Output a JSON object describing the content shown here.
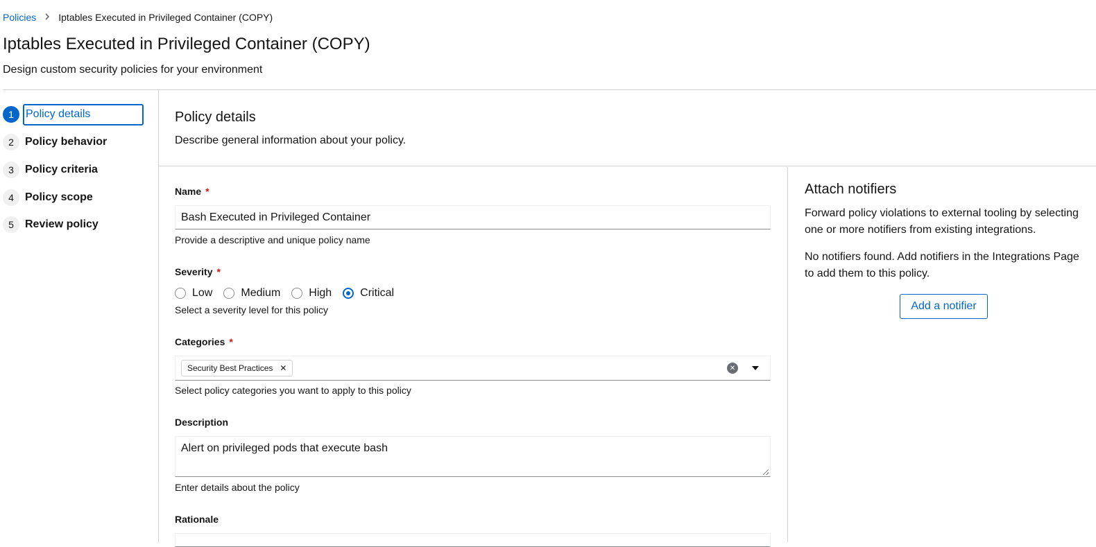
{
  "breadcrumb": {
    "parent": "Policies",
    "current": "Iptables Executed in Privileged Container (COPY)"
  },
  "page": {
    "title": "Iptables Executed in Privileged Container (COPY)",
    "subtitle": "Design custom security policies for your environment"
  },
  "wizard_nav": {
    "steps": [
      {
        "num": "1",
        "label": "Policy details",
        "active": true
      },
      {
        "num": "2",
        "label": "Policy behavior",
        "active": false
      },
      {
        "num": "3",
        "label": "Policy criteria",
        "active": false
      },
      {
        "num": "4",
        "label": "Policy scope",
        "active": false
      },
      {
        "num": "5",
        "label": "Review policy",
        "active": false
      }
    ]
  },
  "section": {
    "title": "Policy details",
    "description": "Describe general information about your policy."
  },
  "form": {
    "name": {
      "label": "Name",
      "required_mark": "*",
      "value": "Bash Executed in Privileged Container",
      "helper": "Provide a descriptive and unique policy name"
    },
    "severity": {
      "label": "Severity",
      "required_mark": "*",
      "options": [
        "Low",
        "Medium",
        "High",
        "Critical"
      ],
      "selected": "Critical",
      "helper": "Select a severity level for this policy"
    },
    "categories": {
      "label": "Categories",
      "required_mark": "*",
      "chips": [
        "Security Best Practices"
      ],
      "helper": "Select policy categories you want to apply to this policy"
    },
    "description": {
      "label": "Description",
      "value": "Alert on privileged pods that execute bash",
      "helper": "Enter details about the policy"
    },
    "rationale": {
      "label": "Rationale"
    }
  },
  "notifiers": {
    "title": "Attach notifiers",
    "intro": "Forward policy violations to external tooling by selecting one or more notifiers from existing integrations.",
    "empty_message": "No notifiers found. Add notifiers in the Integrations Page to add them to this policy.",
    "add_button": "Add a notifier"
  },
  "icons": {
    "breadcrumb_separator": "chevron-right-icon",
    "chip_remove": "close-icon",
    "clear_selection": "times-circle-icon",
    "dropdown_toggle": "caret-down-icon"
  },
  "colors": {
    "accent": "#0066cc",
    "required": "#c9190b",
    "border": "#d2d2d2"
  }
}
